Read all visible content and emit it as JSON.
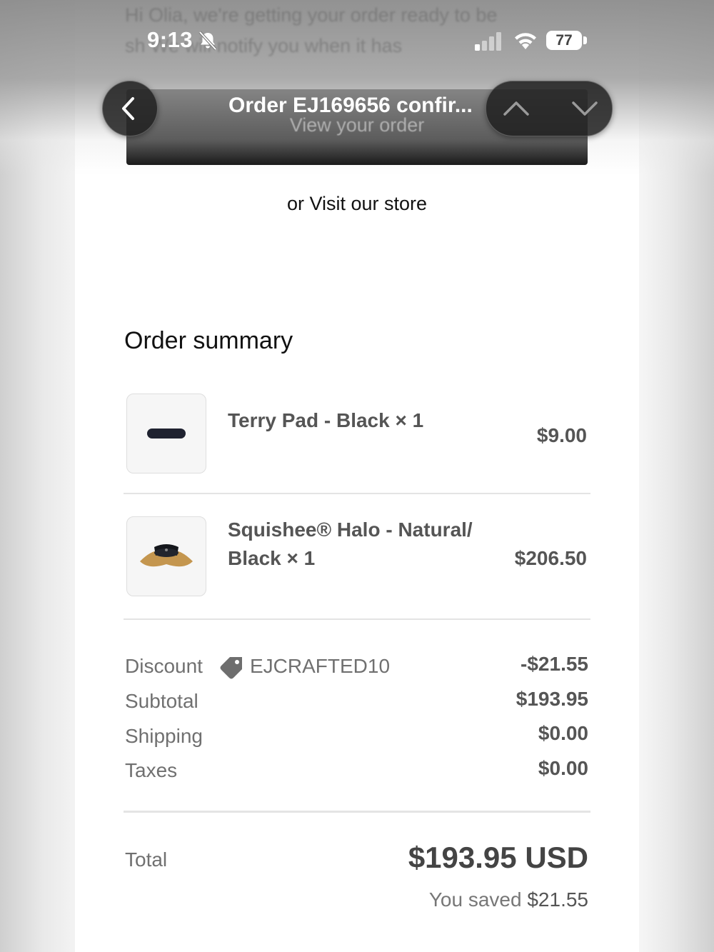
{
  "status_bar": {
    "time": "9:13",
    "battery": "77"
  },
  "background_email": {
    "lines": [
      "Hi Olia, we're getting your order ready to be",
      "sh             We will notify you when it has"
    ],
    "view_order_button": "View your order"
  },
  "nav": {
    "title": "Order EJ169656 confir...",
    "back_icon": "chevron-left-icon",
    "up_icon": "chevron-up-icon",
    "down_icon": "chevron-down-icon"
  },
  "store_link": "or Visit our store",
  "order_summary": {
    "title": "Order summary",
    "items": [
      {
        "name": "Terry Pad - Black × 1",
        "price": "$9.00"
      },
      {
        "name_line1": "Squishee® Halo - Natural/",
        "name_line2": "Black × 1",
        "price": "$206.50"
      }
    ],
    "discount": {
      "label": "Discount",
      "code": "EJCRAFTED10",
      "value": "-$21.55",
      "icon": "tag-icon"
    },
    "subtotal": {
      "label": "Subtotal",
      "value": "$193.95"
    },
    "shipping": {
      "label": "Shipping",
      "value": "$0.00"
    },
    "taxes": {
      "label": "Taxes",
      "value": "$0.00"
    },
    "total": {
      "label": "Total",
      "value": "$193.95 USD"
    },
    "saved": {
      "prefix": "You saved",
      "amount": "$21.55"
    }
  },
  "colors": {
    "button_black": "#000000",
    "text_gray": "#707070",
    "price_gray": "#555555"
  }
}
